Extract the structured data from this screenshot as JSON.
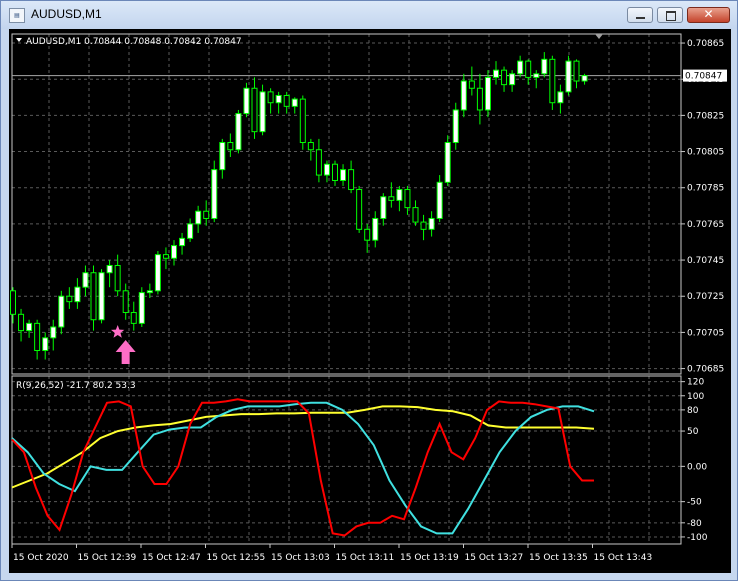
{
  "window": {
    "title": "AUDUSD,M1",
    "controls": {
      "minimize": "minimize",
      "maximize": "maximize",
      "close": "✕"
    }
  },
  "colors": {
    "background": "#000000",
    "grid": "#5a5a5a",
    "bull_candle": "#00ff00",
    "bull_body": "#ffffff",
    "bear_body": "#000000",
    "bid_line": "#a9a9a9",
    "arrow": "#ff6ec7",
    "red_line": "#ff0000",
    "cyan_line": "#40e0e0",
    "yellow_line": "#ffff30"
  },
  "price_panel": {
    "info": "AUDUSD,M1  0.70844 0.70848 0.70842 0.70847",
    "current_price": "0.70847",
    "ticks": [
      "0.70865",
      "0.70845",
      "0.70825",
      "0.70805",
      "0.70785",
      "0.70765",
      "0.70745",
      "0.70725",
      "0.70705",
      "0.70685"
    ]
  },
  "indicator_panel": {
    "info": "R(9,26,52) -21.7 80.2 53.3",
    "ticks": [
      "120",
      "100",
      "80",
      "50",
      "0.00",
      "-50",
      "-80",
      "-100"
    ]
  },
  "time_axis": [
    "15 Oct 2020",
    "15 Oct 12:39",
    "15 Oct 12:47",
    "15 Oct 12:55",
    "15 Oct 13:03",
    "15 Oct 13:11",
    "15 Oct 13:19",
    "15 Oct 13:27",
    "15 Oct 13:35",
    "15 Oct 13:43"
  ],
  "chart_data": {
    "type": "candlestick",
    "symbol": "AUDUSD",
    "timeframe": "M1",
    "price_range": [
      0.70682,
      0.7087
    ],
    "candles": [
      [
        0.70728,
        0.7073,
        0.7071,
        0.70715
      ],
      [
        0.70715,
        0.70718,
        0.707,
        0.70706
      ],
      [
        0.70706,
        0.70712,
        0.70702,
        0.7071
      ],
      [
        0.7071,
        0.70712,
        0.7069,
        0.70695
      ],
      [
        0.70695,
        0.70705,
        0.7069,
        0.70702
      ],
      [
        0.70702,
        0.70712,
        0.70695,
        0.70708
      ],
      [
        0.70708,
        0.70728,
        0.70704,
        0.70725
      ],
      [
        0.70725,
        0.7073,
        0.70718,
        0.70722
      ],
      [
        0.70722,
        0.70735,
        0.70718,
        0.7073
      ],
      [
        0.7073,
        0.70742,
        0.70725,
        0.70738
      ],
      [
        0.70738,
        0.70742,
        0.70706,
        0.70712
      ],
      [
        0.70712,
        0.7074,
        0.7071,
        0.70738
      ],
      [
        0.70738,
        0.70745,
        0.7073,
        0.70742
      ],
      [
        0.70742,
        0.70748,
        0.70725,
        0.70728
      ],
      [
        0.70728,
        0.70732,
        0.70712,
        0.70716
      ],
      [
        0.70716,
        0.70722,
        0.70706,
        0.7071
      ],
      [
        0.7071,
        0.7073,
        0.70708,
        0.70727
      ],
      [
        0.70727,
        0.70732,
        0.70724,
        0.70728
      ],
      [
        0.70728,
        0.7075,
        0.70726,
        0.70748
      ],
      [
        0.70748,
        0.70752,
        0.7074,
        0.70746
      ],
      [
        0.70746,
        0.70756,
        0.70742,
        0.70753
      ],
      [
        0.70753,
        0.7076,
        0.70748,
        0.70757
      ],
      [
        0.70757,
        0.70768,
        0.70755,
        0.70765
      ],
      [
        0.70765,
        0.70775,
        0.7076,
        0.70772
      ],
      [
        0.70772,
        0.70778,
        0.70764,
        0.70768
      ],
      [
        0.70768,
        0.708,
        0.70766,
        0.70795
      ],
      [
        0.70795,
        0.70812,
        0.7079,
        0.7081
      ],
      [
        0.7081,
        0.70815,
        0.70802,
        0.70806
      ],
      [
        0.70806,
        0.70828,
        0.70804,
        0.70826
      ],
      [
        0.70826,
        0.70843,
        0.70824,
        0.7084
      ],
      [
        0.7084,
        0.70846,
        0.70812,
        0.70816
      ],
      [
        0.70816,
        0.70842,
        0.70814,
        0.70838
      ],
      [
        0.70838,
        0.7084,
        0.70826,
        0.70832
      ],
      [
        0.70832,
        0.70838,
        0.70826,
        0.70836
      ],
      [
        0.70836,
        0.70838,
        0.70826,
        0.7083
      ],
      [
        0.7083,
        0.70835,
        0.70826,
        0.70834
      ],
      [
        0.70834,
        0.70836,
        0.70806,
        0.7081
      ],
      [
        0.7081,
        0.70812,
        0.708,
        0.70806
      ],
      [
        0.70806,
        0.70812,
        0.70788,
        0.70792
      ],
      [
        0.70792,
        0.708,
        0.70788,
        0.70798
      ],
      [
        0.70798,
        0.708,
        0.70786,
        0.70789
      ],
      [
        0.70789,
        0.70798,
        0.70786,
        0.70795
      ],
      [
        0.70795,
        0.708,
        0.70782,
        0.70784
      ],
      [
        0.70784,
        0.70786,
        0.7076,
        0.70762
      ],
      [
        0.70762,
        0.70765,
        0.70749,
        0.70756
      ],
      [
        0.70756,
        0.70772,
        0.70752,
        0.70768
      ],
      [
        0.70768,
        0.70782,
        0.70764,
        0.7078
      ],
      [
        0.7078,
        0.70788,
        0.70774,
        0.70778
      ],
      [
        0.70778,
        0.70786,
        0.70772,
        0.70784
      ],
      [
        0.70784,
        0.70786,
        0.7077,
        0.70774
      ],
      [
        0.70774,
        0.70778,
        0.70764,
        0.70766
      ],
      [
        0.70766,
        0.7077,
        0.70756,
        0.70762
      ],
      [
        0.70762,
        0.70772,
        0.70758,
        0.70768
      ],
      [
        0.70768,
        0.70792,
        0.70766,
        0.70788
      ],
      [
        0.70788,
        0.70814,
        0.70786,
        0.7081
      ],
      [
        0.7081,
        0.70832,
        0.70806,
        0.70828
      ],
      [
        0.70828,
        0.70848,
        0.70824,
        0.70844
      ],
      [
        0.70844,
        0.70852,
        0.70836,
        0.7084
      ],
      [
        0.7084,
        0.70848,
        0.7082,
        0.70828
      ],
      [
        0.70828,
        0.7085,
        0.70824,
        0.70846
      ],
      [
        0.70846,
        0.70855,
        0.70842,
        0.7085
      ],
      [
        0.7085,
        0.70852,
        0.70838,
        0.70842
      ],
      [
        0.70842,
        0.7085,
        0.70838,
        0.70848
      ],
      [
        0.70848,
        0.70858,
        0.70846,
        0.70855
      ],
      [
        0.70855,
        0.70856,
        0.70842,
        0.70846
      ],
      [
        0.70846,
        0.7085,
        0.7084,
        0.70848
      ],
      [
        0.70848,
        0.7086,
        0.70846,
        0.70856
      ],
      [
        0.70856,
        0.70858,
        0.70828,
        0.70832
      ],
      [
        0.70832,
        0.70842,
        0.70826,
        0.70838
      ],
      [
        0.70838,
        0.70858,
        0.70836,
        0.70855
      ],
      [
        0.70855,
        0.70856,
        0.7084,
        0.70844
      ],
      [
        0.70844,
        0.70848,
        0.70842,
        0.70847
      ]
    ],
    "signal": {
      "candle_index": 13,
      "symbol": "star + up arrow",
      "price": 0.70703
    },
    "indicator": {
      "name": "R(9,26,52)",
      "range": [
        -110,
        128
      ],
      "red": [
        38,
        20,
        -30,
        -70,
        -90,
        -40,
        20,
        55,
        90,
        92,
        85,
        0,
        -25,
        -25,
        0,
        60,
        90,
        90,
        92,
        95,
        92,
        92,
        92,
        92,
        92,
        75,
        -20,
        -95,
        -98,
        -85,
        -80,
        -80,
        -70,
        -75,
        -30,
        20,
        60,
        20,
        10,
        40,
        80,
        92,
        90,
        90,
        88,
        85,
        82,
        0,
        -20,
        -20
      ],
      "cyan": [
        40,
        20,
        -10,
        -25,
        -35,
        0,
        -5,
        -5,
        20,
        45,
        52,
        55,
        55,
        70,
        80,
        85,
        85,
        85,
        88,
        90,
        90,
        80,
        60,
        30,
        -20,
        -55,
        -85,
        -95,
        -95,
        -60,
        -20,
        20,
        50,
        70,
        80,
        85,
        85,
        78
      ],
      "yellow": [
        -30,
        -20,
        -10,
        5,
        20,
        40,
        50,
        55,
        58,
        60,
        65,
        70,
        72,
        74,
        74,
        75,
        75,
        76,
        76,
        76,
        80,
        85,
        85,
        84,
        80,
        78,
        72,
        58,
        55,
        55,
        55,
        55,
        55,
        53.3
      ]
    }
  }
}
